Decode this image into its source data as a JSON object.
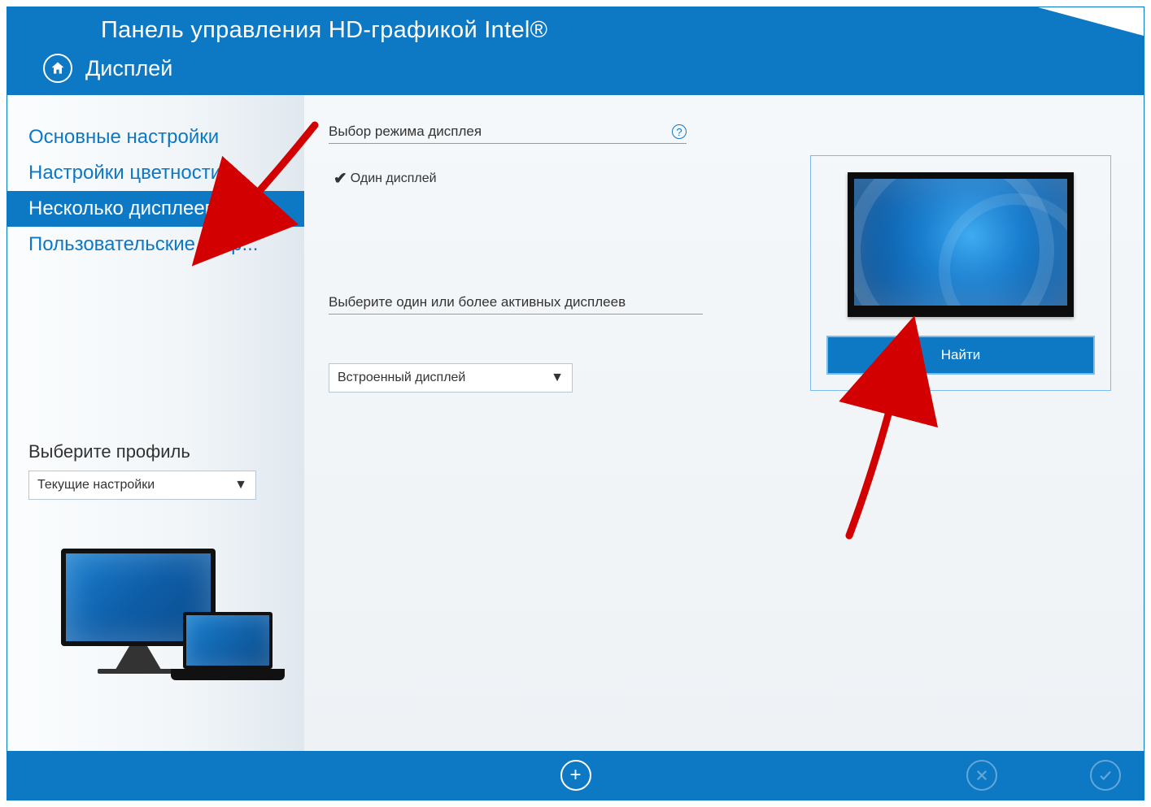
{
  "header": {
    "title": "Панель управления HD-графикой Intel®",
    "section": "Дисплей"
  },
  "sidebar": {
    "items": [
      {
        "label": "Основные настройки"
      },
      {
        "label": "Настройки цветности"
      },
      {
        "label": "Несколько дисплеев"
      },
      {
        "label": "Пользовательские разр..."
      }
    ],
    "active_index": 2,
    "profile_label": "Выберите профиль",
    "profile_value": "Текущие настройки"
  },
  "main": {
    "mode_label": "Выбор режима дисплея",
    "mode_option": "Один дисплей",
    "active_label": "Выберите один или более активных дисплеев",
    "display_dropdown": "Встроенный дисплей",
    "find_button": "Найти"
  },
  "colors": {
    "accent": "#0d78c4"
  }
}
